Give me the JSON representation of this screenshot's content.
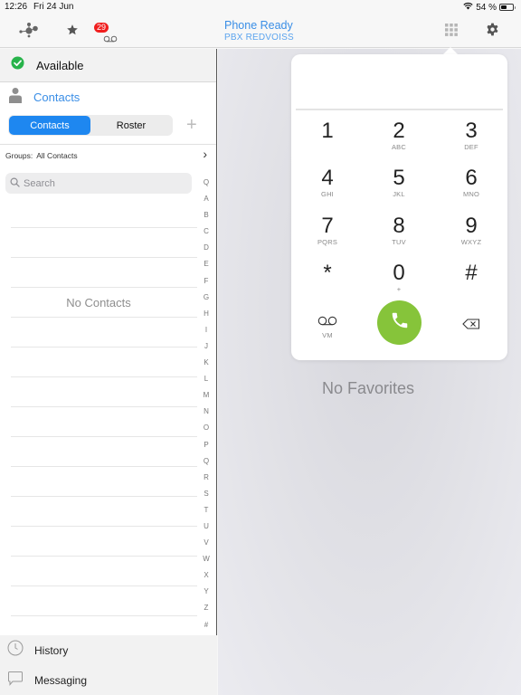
{
  "status_bar": {
    "time": "12:26",
    "date": "Fri 24 Jun",
    "battery_percent_label": "54 %",
    "battery_level": 0.54
  },
  "topbar": {
    "title": "Phone Ready",
    "subtitle": "PBX REDVOISS",
    "voicemail_badge": "29",
    "icons": [
      "network-icon",
      "favorites-star-icon",
      "voicemail-icon",
      "dialpad-grid-icon",
      "settings-gear-icon"
    ]
  },
  "sidebar": {
    "presence": "Available",
    "section_title": "Contacts",
    "segments": [
      {
        "label": "Contacts",
        "active": true
      },
      {
        "label": "Roster",
        "active": false
      }
    ],
    "groups_label": "Groups:",
    "groups_value": "All Contacts",
    "search_placeholder": "Search",
    "empty_text": "No Contacts",
    "index_letters": [
      "Q",
      "A",
      "B",
      "C",
      "D",
      "E",
      "F",
      "G",
      "H",
      "I",
      "J",
      "K",
      "L",
      "M",
      "N",
      "O",
      "P",
      "Q",
      "R",
      "S",
      "T",
      "U",
      "V",
      "W",
      "X",
      "Y",
      "Z",
      "#"
    ],
    "bottom_nav": [
      {
        "label": "History",
        "icon": "clock-icon"
      },
      {
        "label": "Messaging",
        "icon": "chat-bubble-icon"
      }
    ]
  },
  "main": {
    "empty_text": "No Favorites"
  },
  "dialpad": {
    "display_value": "",
    "keys": [
      {
        "digit": "1",
        "letters": ""
      },
      {
        "digit": "2",
        "letters": "ABC"
      },
      {
        "digit": "3",
        "letters": "DEF"
      },
      {
        "digit": "4",
        "letters": "GHI"
      },
      {
        "digit": "5",
        "letters": "JKL"
      },
      {
        "digit": "6",
        "letters": "MNO"
      },
      {
        "digit": "7",
        "letters": "PQRS"
      },
      {
        "digit": "8",
        "letters": "TUV"
      },
      {
        "digit": "9",
        "letters": "WXYZ"
      },
      {
        "digit": "*",
        "letters": ""
      },
      {
        "digit": "0",
        "letters": "+"
      },
      {
        "digit": "#",
        "letters": ""
      }
    ],
    "voicemail_label": "VM",
    "call_color": "#86c43a"
  },
  "colors": {
    "accent": "#1e87f0",
    "link": "#3a8ee6",
    "presence_green": "#27b34a",
    "badge_red": "#f01e1e"
  }
}
